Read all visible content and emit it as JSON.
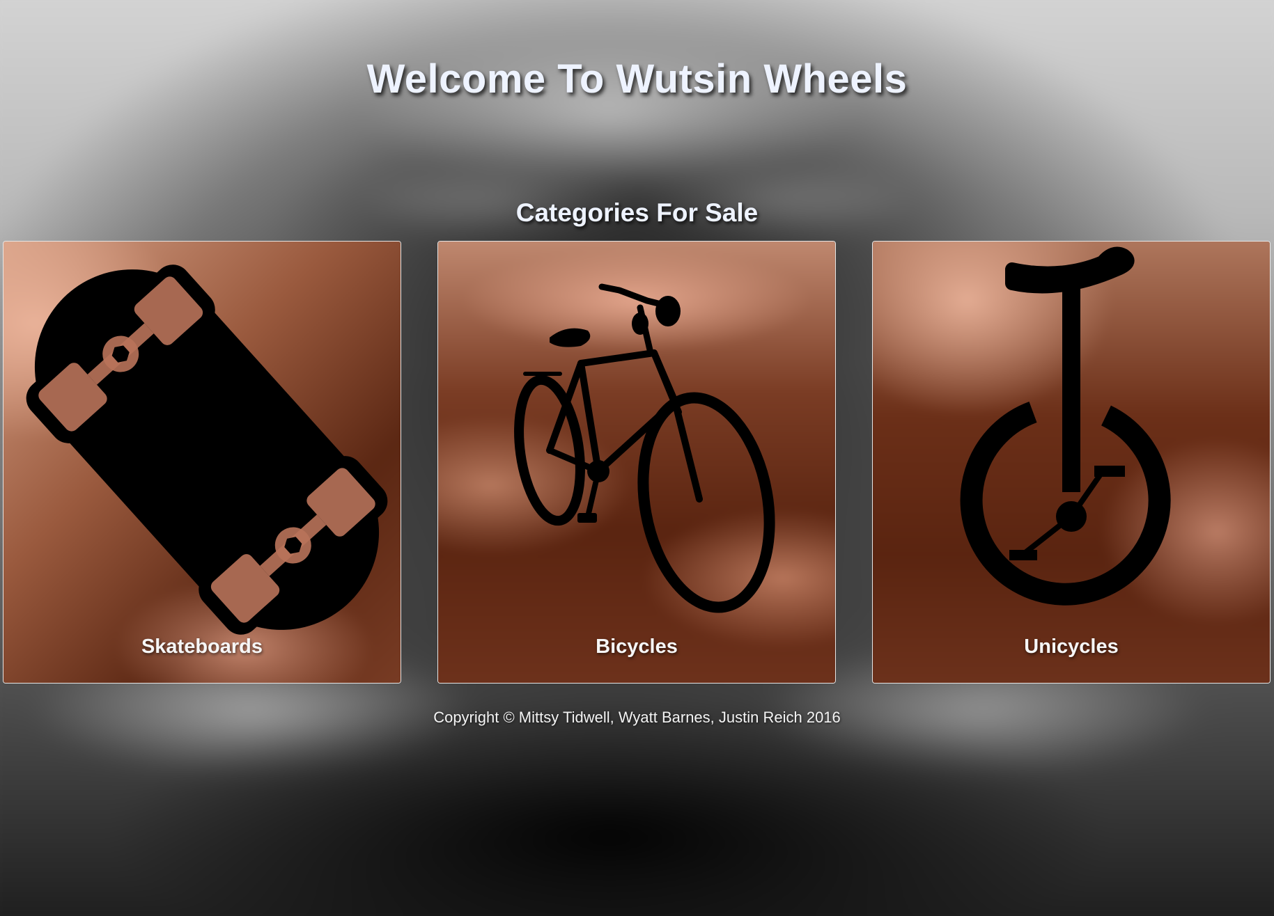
{
  "header": {
    "title": "Welcome To Wutsin Wheels",
    "subtitle": "Categories For Sale"
  },
  "categories": [
    {
      "label": "Skateboards",
      "icon": "skateboard-icon"
    },
    {
      "label": "Bicycles",
      "icon": "bicycle-icon"
    },
    {
      "label": "Unicycles",
      "icon": "unicycle-icon"
    }
  ],
  "footer": {
    "copyright": "Copyright © Mittsy Tidwell, Wyatt Barnes, Justin Reich 2016"
  },
  "colors": {
    "card_tint": "#5a2410",
    "card_highlight": "#dba68c",
    "card_border": "#e6e6e6",
    "title_text": "#eef3ff",
    "icon": "#000000"
  }
}
